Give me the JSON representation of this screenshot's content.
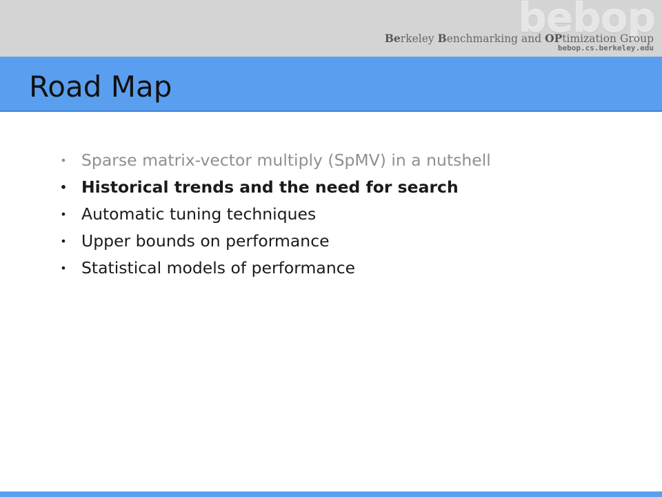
{
  "header": {
    "logo_text": "bebop",
    "group_name_parts": [
      {
        "text": "Be",
        "bold": true
      },
      {
        "text": "rkeley ",
        "bold": false
      },
      {
        "text": "B",
        "bold": true
      },
      {
        "text": "enchmarking and ",
        "bold": false
      },
      {
        "text": "OP",
        "bold": true
      },
      {
        "text": "timization Group",
        "bold": false
      }
    ],
    "url": "bebop.cs.berkeley.edu"
  },
  "slide": {
    "title": "Road Map",
    "bullets": [
      {
        "text": "Sparse matrix-vector multiply (SpMV) in a nutshell",
        "state": "muted"
      },
      {
        "text": "Historical trends and the need for search",
        "state": "active"
      },
      {
        "text": "Automatic tuning techniques",
        "state": "normal"
      },
      {
        "text": "Upper bounds on performance",
        "state": "normal"
      },
      {
        "text": "Statistical models of performance",
        "state": "normal"
      }
    ],
    "bullet_glyph": "•"
  },
  "colors": {
    "title_bar": "#5a9fef",
    "header_band": "#d4d4d4",
    "muted_text": "#8f8f8f"
  }
}
